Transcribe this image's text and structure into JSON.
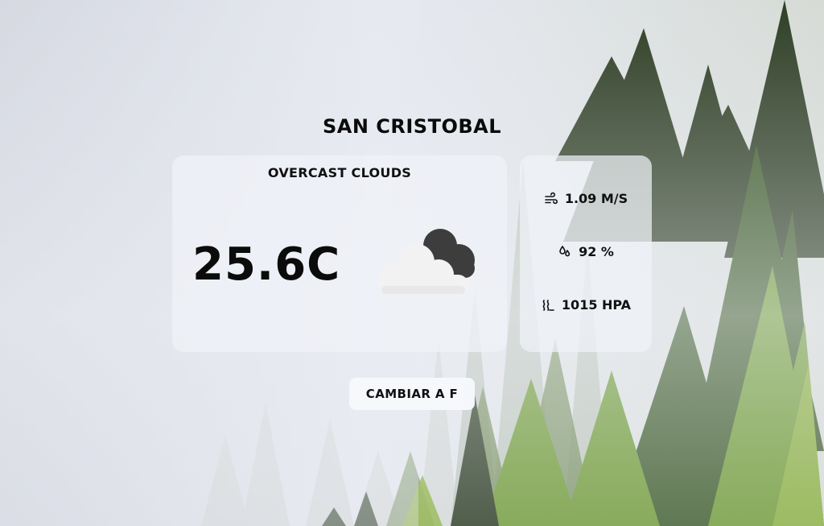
{
  "city": "SAN CRISTOBAL",
  "weather": {
    "description": "OVERCAST CLOUDS",
    "temperature": "25.6C",
    "icon": "overcast-clouds-icon"
  },
  "stats": {
    "wind": "1.09 M/S",
    "wind_icon": "wind-icon",
    "humidity": "92 %",
    "humidity_icon": "humidity-icon",
    "pressure": "1015 HPA",
    "pressure_icon": "pressure-icon"
  },
  "toggle_button": "CAMBIAR A F",
  "colors": {
    "text": "#0b0b0b",
    "card": "#f0f2f8",
    "cloud_dark": "#3d3d3d",
    "cloud_light": "#f2f2f2"
  }
}
